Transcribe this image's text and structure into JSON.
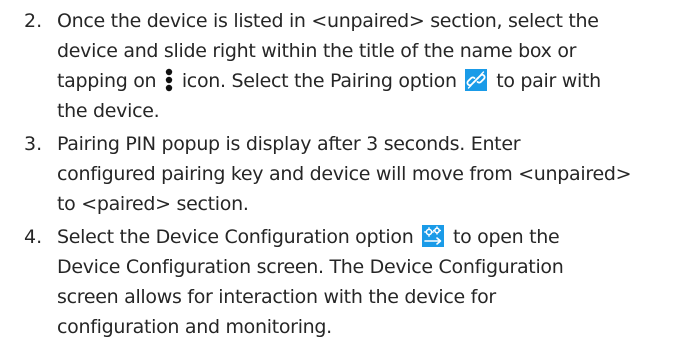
{
  "steps": [
    {
      "number": "2.",
      "line1": "Once the device is listed in <unpaired> section, select the",
      "line2": "device and slide right within the title of the name box or",
      "line3_a": "tapping on",
      "more_icon": "vertical-three-dots-icon",
      "line3_b": "icon. Select the Pairing option",
      "pairing_icon": "pairing-link-icon",
      "line3_c": "to pair with",
      "line4": "the device."
    },
    {
      "number": "3.",
      "line1": "Pairing PIN popup is display after 3 seconds. Enter",
      "line2": "configured pairing key and device will move from <unpaired>",
      "line3": "to <paired> section."
    },
    {
      "number": "4.",
      "line1_a": "Select the Device Configuration option",
      "config_icon": "device-configuration-icon",
      "line1_b": "to open the",
      "line2": "Device Configuration screen. The Device Configuration",
      "line3": "screen allows for interaction with the device for",
      "line4": "configuration and monitoring."
    }
  ],
  "colors": {
    "text": "#262626",
    "icon_background": "#1a9be8",
    "icon_foreground": "#ffffff"
  }
}
